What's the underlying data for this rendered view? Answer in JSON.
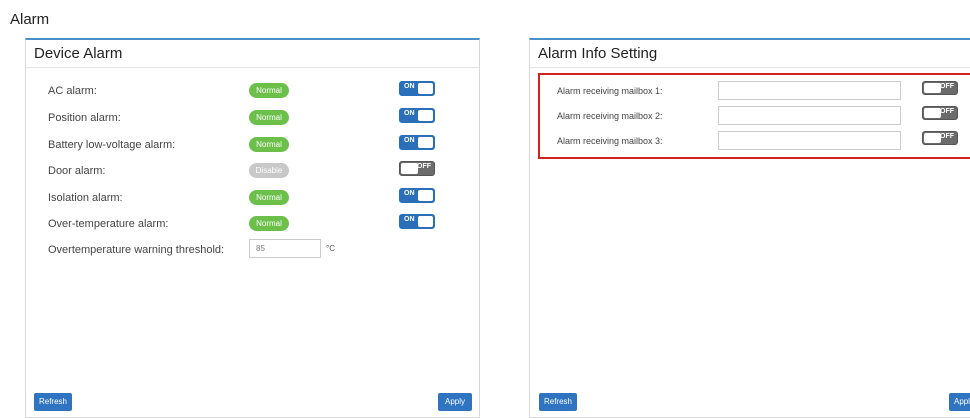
{
  "page": {
    "title": "Alarm"
  },
  "device_alarm": {
    "title": "Device Alarm",
    "rows": [
      {
        "label": "AC alarm:",
        "status": "Normal",
        "toggle": "ON"
      },
      {
        "label": "Position alarm:",
        "status": "Normal",
        "toggle": "ON"
      },
      {
        "label": "Battery low-voltage alarm:",
        "status": "Normal",
        "toggle": "ON"
      },
      {
        "label": "Door alarm:",
        "status": "Disable",
        "toggle": "OFF"
      },
      {
        "label": "Isolation alarm:",
        "status": "Normal",
        "toggle": "ON"
      },
      {
        "label": "Over-temperature alarm:",
        "status": "Normal",
        "toggle": "ON"
      }
    ],
    "threshold": {
      "label": "Overtemperature warning threshold:",
      "value": "85",
      "unit": "°C"
    },
    "refresh_label": "Refresh",
    "apply_label": "Apply"
  },
  "alarm_info": {
    "title": "Alarm Info Setting",
    "mailboxes": [
      {
        "label": "Alarm receiving mailbox 1:",
        "value": "",
        "toggle": "OFF"
      },
      {
        "label": "Alarm receiving mailbox 2:",
        "value": "",
        "toggle": "OFF"
      },
      {
        "label": "Alarm receiving mailbox 3:",
        "value": "",
        "toggle": "OFF"
      }
    ],
    "refresh_label": "Refresh",
    "apply_label": "Apply"
  },
  "colors": {
    "accent": "#2f74c0",
    "normal_badge": "#6cc04a",
    "disable_badge": "#c8c8c8",
    "toggle_off": "#6b6b6b",
    "highlight": "#d42020"
  }
}
